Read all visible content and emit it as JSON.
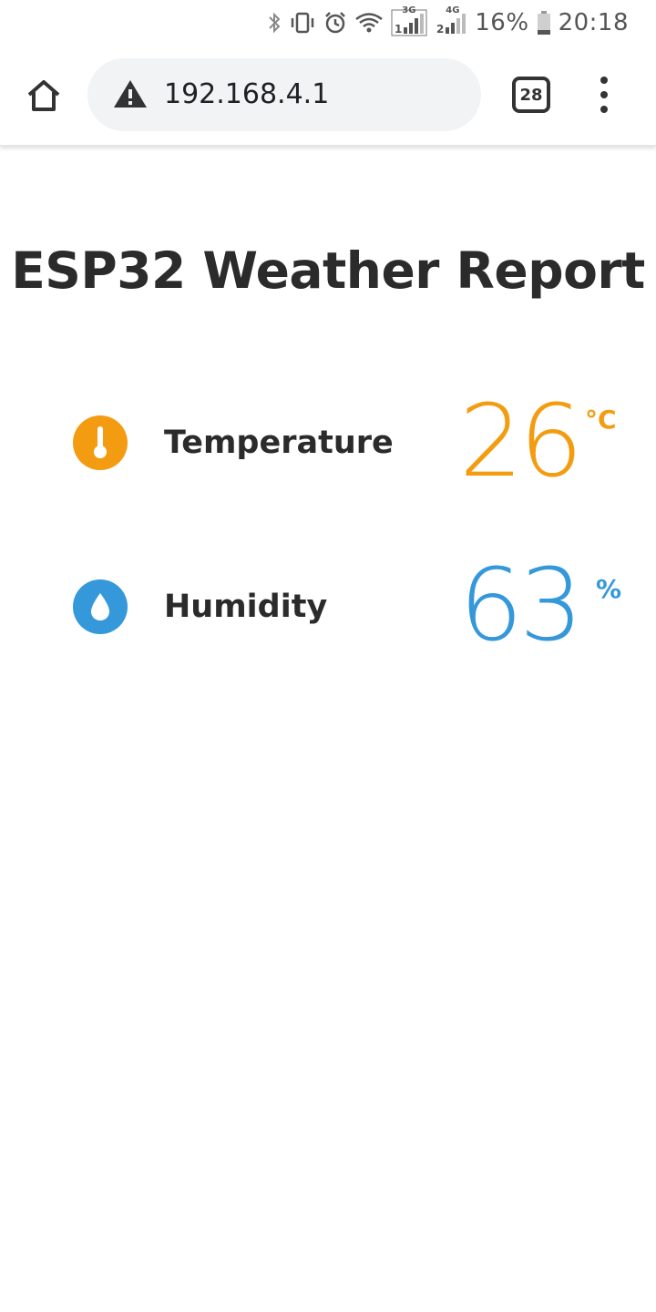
{
  "status_bar": {
    "icons": [
      "bluetooth-icon",
      "vibrate-icon",
      "alarm-icon",
      "wifi-icon",
      "signal-3g-icon",
      "signal-4g-icon",
      "battery-icon"
    ],
    "network_1": "3G",
    "network_2": "4G",
    "sim_1": "1",
    "sim_2": "2",
    "battery_percent": "16%",
    "time": "20:18"
  },
  "browser": {
    "url": "192.168.4.1",
    "tab_count": "28",
    "security_icon": "warning-icon",
    "home_icon": "home-icon",
    "menu_icon": "more-vert-icon"
  },
  "page": {
    "title": "ESP32 Weather Report",
    "readings": [
      {
        "label": "Temperature",
        "value": "26",
        "unit": "°C",
        "icon": "thermometer-icon",
        "color": "#f39c12"
      },
      {
        "label": "Humidity",
        "value": "63",
        "unit": "%",
        "icon": "water-drop-icon",
        "color": "#3498db"
      }
    ]
  },
  "colors": {
    "temperature": "#f39c12",
    "humidity": "#3498db",
    "text": "#2b2b2b",
    "omnibox_bg": "#f1f3f4"
  }
}
